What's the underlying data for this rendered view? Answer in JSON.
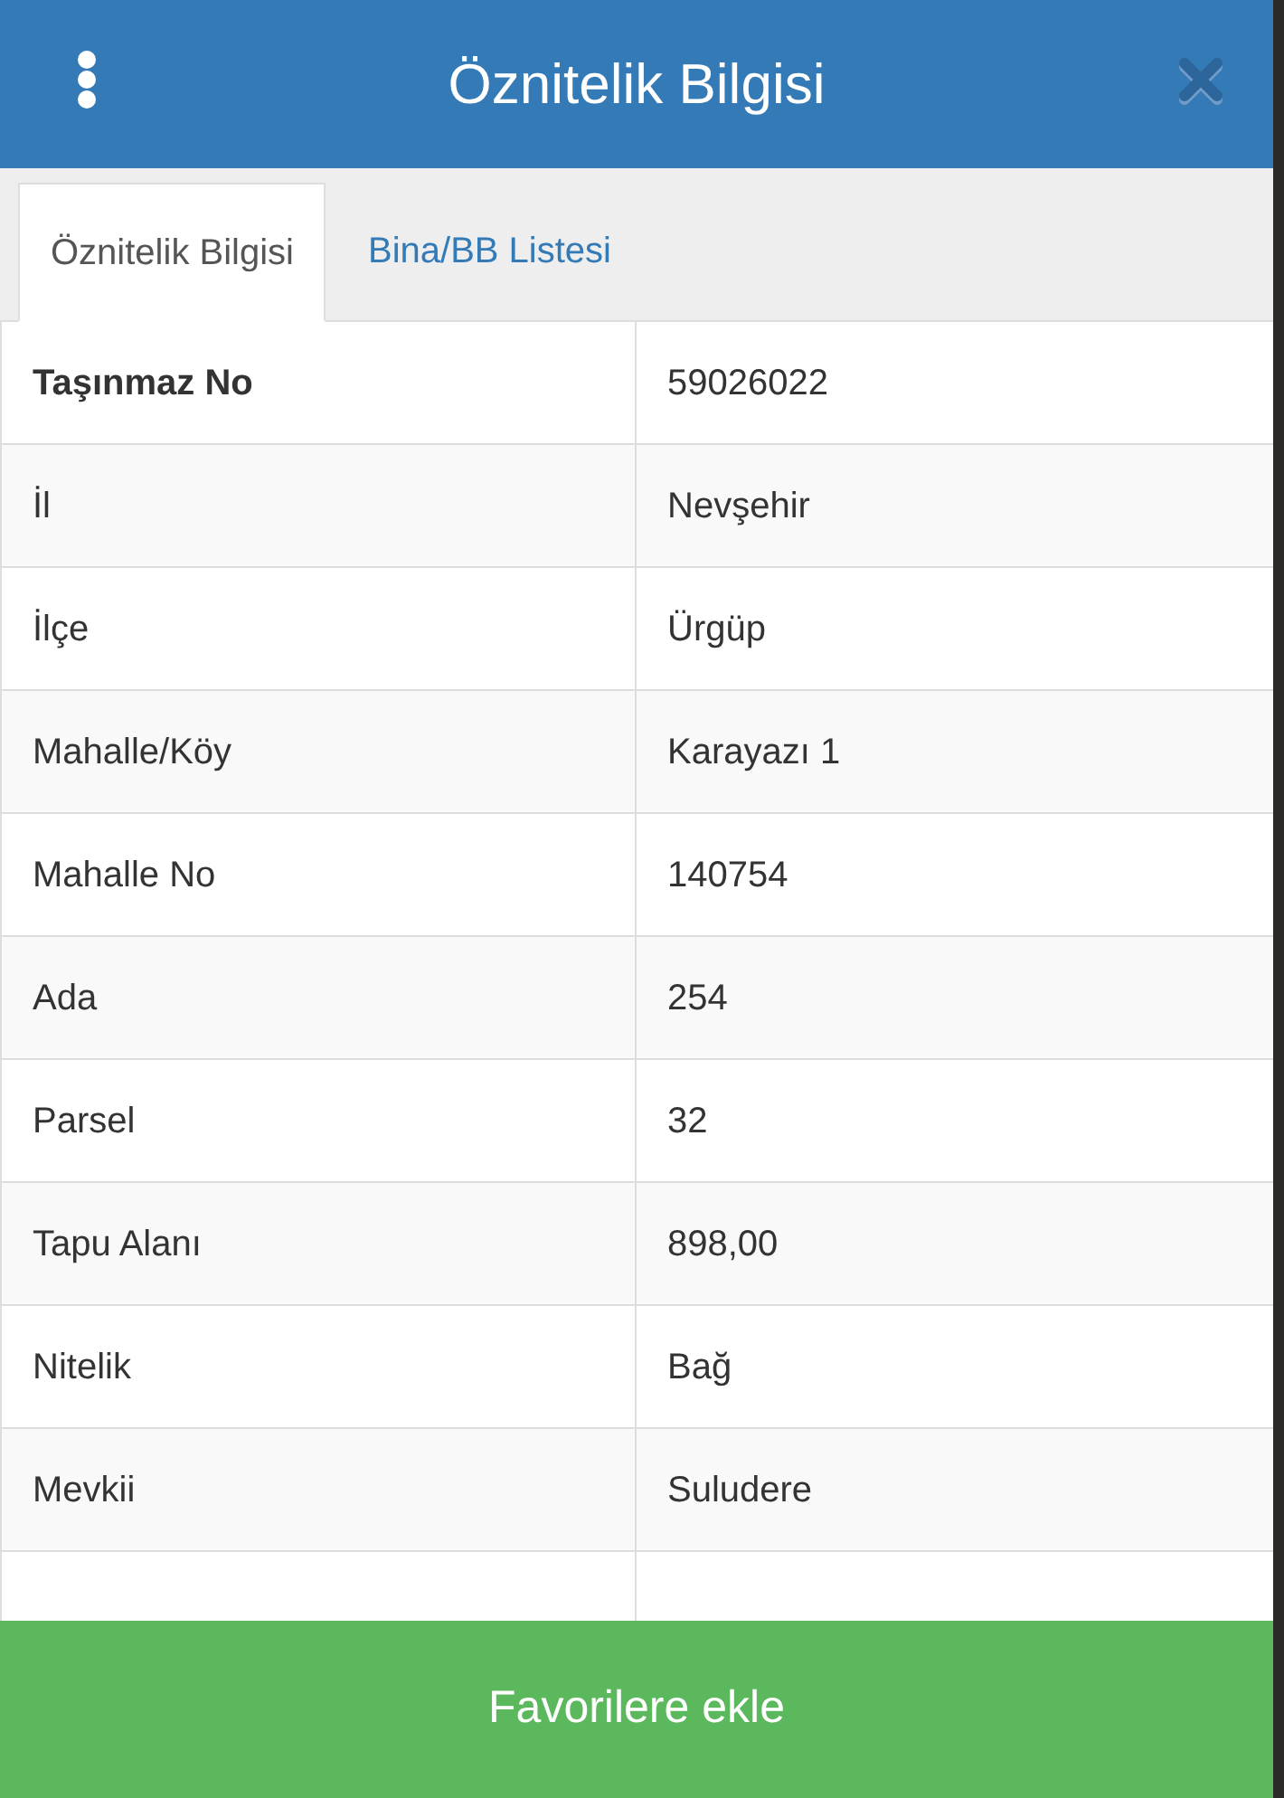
{
  "header": {
    "title": "Öznitelik Bilgisi"
  },
  "tabs": [
    {
      "label": "Öznitelik Bilgisi",
      "selected": true
    },
    {
      "label": "Bina/BB Listesi",
      "selected": false
    }
  ],
  "table": {
    "rows": [
      {
        "label": "Taşınmaz No",
        "value": "59026022",
        "bold": true
      },
      {
        "label": "İl",
        "value": "Nevşehir",
        "bold": false
      },
      {
        "label": "İlçe",
        "value": "Ürgüp",
        "bold": false
      },
      {
        "label": "Mahalle/Köy",
        "value": "Karayazı 1",
        "bold": false
      },
      {
        "label": "Mahalle No",
        "value": "140754",
        "bold": false
      },
      {
        "label": "Ada",
        "value": "254",
        "bold": false
      },
      {
        "label": "Parsel",
        "value": "32",
        "bold": false
      },
      {
        "label": "Tapu Alanı",
        "value": "898,00",
        "bold": false
      },
      {
        "label": "Nitelik",
        "value": "Bağ",
        "bold": false
      },
      {
        "label": "Mevkii",
        "value": "Suludere",
        "bold": false
      }
    ]
  },
  "button": {
    "label": "Favorilere ekle"
  }
}
